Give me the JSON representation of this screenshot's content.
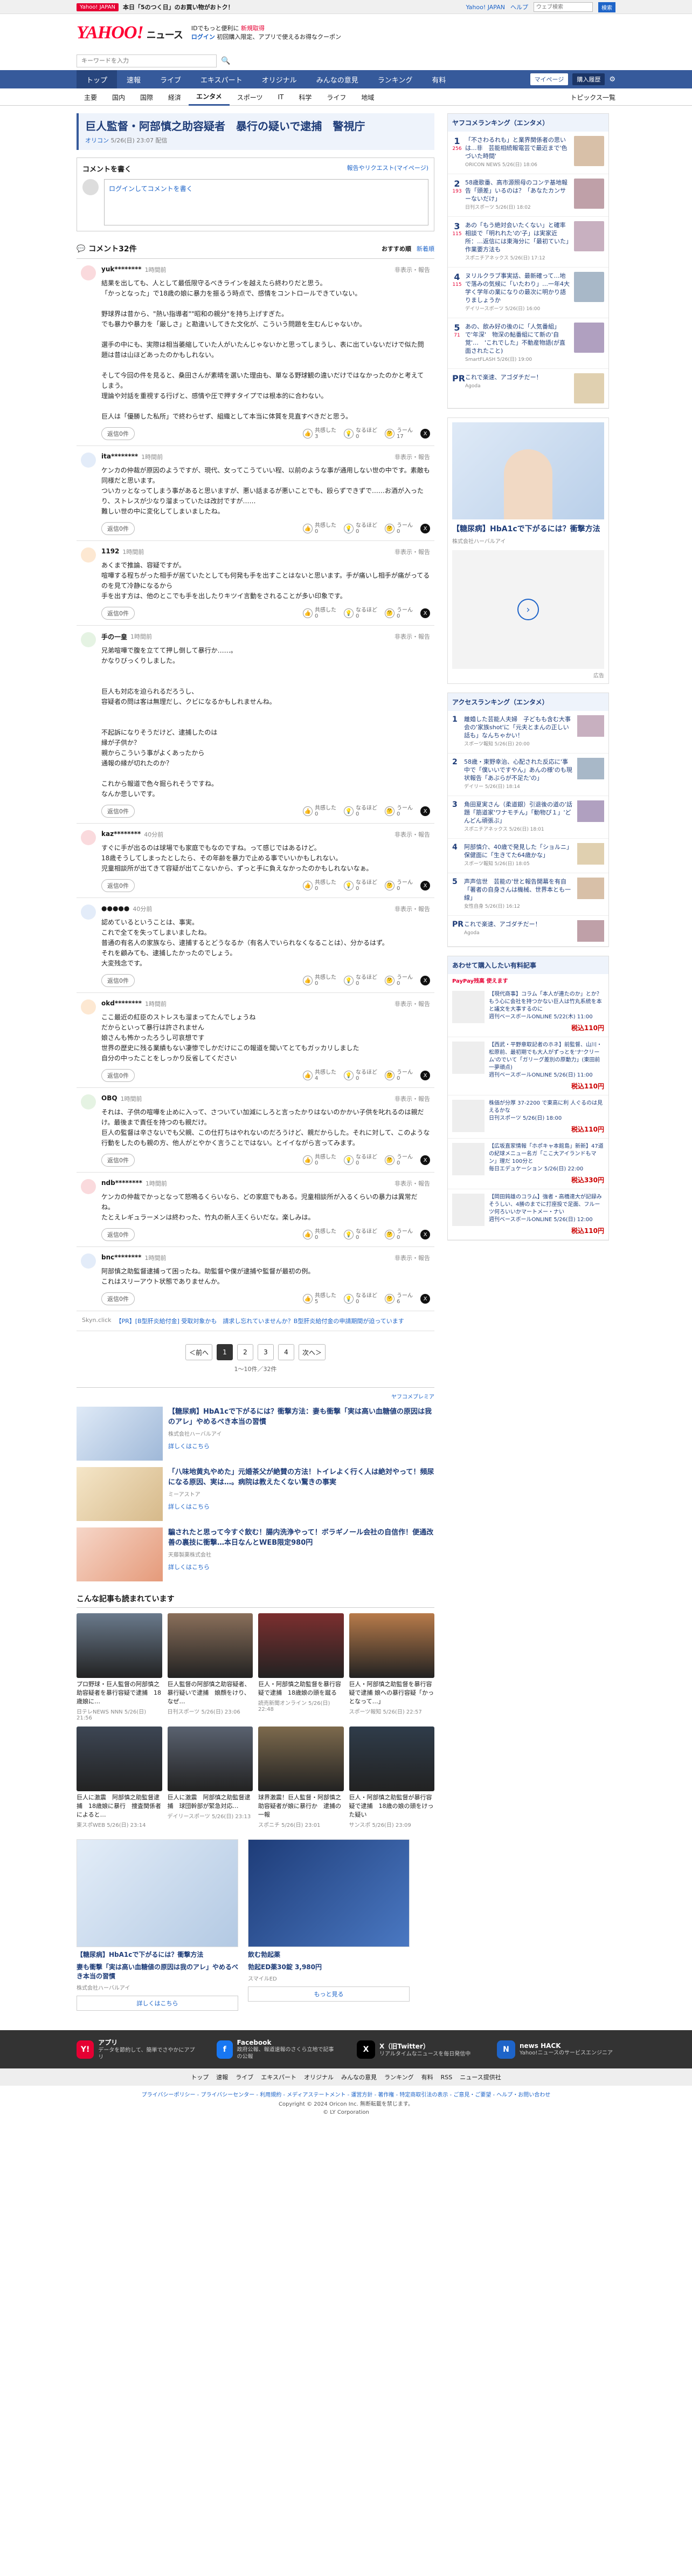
{
  "topbar": {
    "badge": "Yahoo! JAPAN",
    "msg": "本日「5のつく日」のお買い物がおトク！",
    "l1": "Yahoo! JAPAN",
    "l2": "ヘルプ",
    "search_ph": "ウェブ検索",
    "sbtn": "検索",
    "new": "新規取得",
    "login": "ログイン"
  },
  "header": {
    "logo": "YAHOO!",
    "logo_sub": "JAPAN",
    "logo_news": "ニュース",
    "sub1": "IDでもっと便利に",
    "sub1b": "新規取得",
    "sub2a": "ログイン",
    "sub2b": "初回購入限定、アプリで使えるお得なクーポン"
  },
  "search": {
    "placeholder": "キーワードを入力",
    "btn": "検索"
  },
  "gnav": [
    "トップ",
    "速報",
    "ライブ",
    "エキスパート",
    "オリジナル",
    "みんなの意見",
    "ランキング",
    "有料"
  ],
  "gnav_rt": {
    "p1": "マイページ",
    "p2": "購入履歴"
  },
  "snav": [
    "主要",
    "国内",
    "国際",
    "経済",
    "エンタメ",
    "スポーツ",
    "IT",
    "科学",
    "ライフ",
    "地域"
  ],
  "snav_rt": "トピックス一覧",
  "article": {
    "title": "巨人監督・阿部慎之助容疑者　暴行の疑いで逮捕　警視庁",
    "source": "オリコン",
    "time": "5/26(日) 23:07 配信"
  },
  "comment_box": {
    "title": "コメントを書く",
    "link": "報告やリクエスト(マイページ)",
    "input": "ログインしてコメントを書く"
  },
  "comment_head": {
    "title": "コメント32件",
    "s1": "おすすめ順",
    "s2": "新着順"
  },
  "reaction_labels": {
    "a": "共感した",
    "b": "なるほど",
    "c": "うーん"
  },
  "reply_label": "返信0件",
  "report": "非表示・報告",
  "comments": [
    {
      "user": "yuk********",
      "time": "1時間前",
      "text": "結果を出しても、人として最低限守るべきラインを越えたら終わりだと思う。\n「かっとなった」で18歳の娘に暴力を振るう時点で、感情をコントロールできていない。\n\n野球界は昔から、\"熱い指導者\"\"昭和の親分\"を持ち上げすぎた。\nでも暴力や暴力を「厳しさ」と勘違いしてきた文化が、こういう問題を生むんじゃないか。\n\n選手の中にも、実際は相当萎縮していた人がいたんじゃないかと思ってしまうし、表に出ていないだけで似た問題は昔は山ほどあったのかもしれない。\n\nそして今回の件を見ると、桑田さんが素晴を選いた理由も、單なる野球観の違いだけではなかったのかと考えてしまう。\n理論や対話を重視する行げと、感情や圧で押すタイプでは根本的に合わない。\n\n巨人は「優勝した私所」で終わらせず、組織として本当に体質を見直すべきだと思う。",
      "n1": "3",
      "n2": "0",
      "n3": "17"
    },
    {
      "user": "ita********",
      "time": "1時間前",
      "text": "ケンカの仲裁が原因のようですが、現代、女ってこうていい程、以前のような事が通用しない世の中です。素敵も同様だと思います。\nついカッとなってしまう事があると思いますが、悪い話まるが悪いことでも、殴らずできずで……お酒が入ったり、ストレスが少なり溜まっていたは改討ですが……\n難しい世の中に変化してしまいましたね。",
      "n1": "0",
      "n2": "0",
      "n3": "0"
    },
    {
      "user": "1192",
      "time": "1時間前",
      "text": "あくまで推論、容疑ですが。\n喧嘩する程ちがった相手が居ていたとしても何発も手を出すことはないと思います。手が痛いし相手が痛がってるのを見て冷静になるから\n手を出す方は、他のとこでも手を出したりキツイ言動をされることが多い印象です。",
      "n1": "0",
      "n2": "0",
      "n3": "0"
    },
    {
      "user": "手の一皇",
      "time": "1時間前",
      "text": "兄弟喧嘩で腹を立てて押し倒して暴行か……。\nかなりびっくりしました。\n\n\n巨人も対応を迫られるだろうし、\n容疑者の問は客は無理だし、クビになるかもしれませんね。\n\n\n不起訴になりそうだけど、逮捕したのは\n縁が子供か？\n親からこういう事がよくあったから\n通報の縁が切れたのか？\n\nこれから報道で色々掘られそうですね。\nなんか悲しいです。",
      "n1": "0",
      "n2": "0",
      "n3": "0"
    },
    {
      "user": "kaz********",
      "time": "40分前",
      "text": "すぐに手が出るのは球場でも家庭でもなのですね。って感じではあるけど。\n18歳そうしてしまったとしたら、その年齢を暴力で止める事でいいかもしれない。\n児童相談所が出てきて容疑が出てこないから、ずっと手に負えなかったのかもしれないなぁ。",
      "n1": "0",
      "n2": "0",
      "n3": "0"
    },
    {
      "user": "●●●●●",
      "time": "40分前",
      "text": "認めているということは、事実。\nこれで全てを失ってしまいましたね。\n普通の有名人の家族なら、逮捕するとどうなるか（有名人でいられなくなることは）、分かるはず。\nそれを顧みても、逮捕したかったのでしょう。\n大変残念です。",
      "n1": "0",
      "n2": "0",
      "n3": "0"
    },
    {
      "user": "okd********",
      "time": "1時間前",
      "text": "ここ最近の紅臣のストレスも溜まってたんでしょうね\nだからといって暴行は許されません\n娘さんも怖かったろうし可哀想です\n世界の歴史に残る業績もない凄惨でしかだけにこの報道を聞いてとてもガッカリしました\n自分の中ったことをしっかり反省してください",
      "n1": "4",
      "n2": "0",
      "n3": "0"
    },
    {
      "user": "OBQ",
      "time": "1時間前",
      "text": "それは、子供の喧嘩を止めに入って、さついてい加減にしろと言ったかりはないのかかい子供を叱れるのは親だけ。最後まで責任を持つのも親だけ。\n巨人の監督は辛さないでも父親、この仕打ちはやれないのだろうけど、親だからした。それに対して、このような行動をしたのも親の方、他人がとやかく言うことではない。とイイながら言ってみます。",
      "n1": "0",
      "n2": "0",
      "n3": "0"
    },
    {
      "user": "ndb********",
      "time": "1時間前",
      "text": "ケンカの仲裁でかっとなって怒鳴るくらいなら、どの家庭でもある。児童相談所が入るくらいの暴力は異常だね。\nたとえレギュラーメンは終わった、竹丸の新人王くらいだな。楽しみは。",
      "n1": "0",
      "n2": "0",
      "n3": "0"
    },
    {
      "user": "bnc********",
      "time": "1時間前",
      "text": "阿部慎之助監督逮捕って困ったね。助監督や僕が逮捕や監督が最初の例。\nこれはスリーアウト状態でありませんか。",
      "n1": "5",
      "n2": "0",
      "n3": "6"
    }
  ],
  "adline": {
    "pr": "Skyn.click",
    "text": "【PR】[B型肝炎給付金] 受取対象かも　請求し忘れていませんか？B型肝炎給付金の申請期間が迫っています"
  },
  "pager": {
    "prev": "＜前へ",
    "next": "次へ＞",
    "pages": [
      "1",
      "2",
      "3",
      "4"
    ],
    "count": "1〜10件／32件"
  },
  "ads_label": "ヤフコメプレミア",
  "ads": [
    {
      "title": "【糖尿病】HbA1cで下がるには？衝撃方法：妻も衝撃「実は高い血糖値の原因は我のアレ」やめるべき本当の習慣",
      "sp": "株式会社ハーバルアイ",
      "more": "詳しくはこちら"
    },
    {
      "title": "「八味地黄丸やめた」元婚茶父が絶賛の方法！トイレよく行く人は絶対やって！頻尿になる原因、実は…。病院は教えたくない驚きの事実",
      "sp": "ミーアストア",
      "more": "詳しくはこちら"
    },
    {
      "title": "騙されたと思って今すぐ飲む！腸内洗浄やって！ボラギノール会社の自信作！便通改善の裏技に衝撃…本日なんとWEB限定980円",
      "sp": "天藤製薬株式会社",
      "more": "詳しくはこちら"
    }
  ],
  "recos_title": "こんな記事も読まれています",
  "recos": [
    {
      "t": "プロ野球・巨人監督の阿部慎之助容疑者を暴行容疑で逮捕　18歳娘に…",
      "s": "日テレNEWS NNN 5/26(日) 21:56"
    },
    {
      "t": "巨人監督の阿部慎之助容疑者、暴行疑いで逮捕　娘顔をけり、なぜ…",
      "s": "日刊スポーツ 5/26(日) 23:06"
    },
    {
      "t": "巨人・阿部慎之助監督を暴行容疑で逮捕　18歳娘の頭を蹴る",
      "s": "読売新聞オンライン 5/26(日) 22:48"
    },
    {
      "t": "巨人・阿部慎之助監督を暴行容疑で逮捕 娘への暴行容疑「かっとなって…」",
      "s": "スポーツ報知 5/26(日) 22:57"
    },
    {
      "t": "巨人に激震　阿部慎之助監督逮捕　18歳娘に暴行　捜査関係者によると…",
      "s": "東スポWEB 5/26(日) 23:14"
    },
    {
      "t": "巨人に激震　阿部慎之助監督逮捕　球団幹部が緊急対応…",
      "s": "デイリースポーツ 5/26(日) 23:13"
    },
    {
      "t": "球界激震！巨人監督・阿部慎之助容疑者が娘に暴行か　逮捕の一報",
      "s": "スポニチ 5/26(日) 23:01"
    },
    {
      "t": "巨人・阿部慎之助監督が暴行容疑で逮捕　18歳の娘の頭をけった疑い",
      "s": "サンスポ 5/26(日) 23:09"
    }
  ],
  "bads": [
    {
      "title": "【糖尿病】HbA1cで下がるには？衝撃方法",
      "t2": "妻も衝撃「実は高い血糖値の原因は我のアレ」やめるべき本当の習慣",
      "sp": "株式会社ハーバルアイ",
      "more": "詳しくはこちら"
    },
    {
      "title": "飲む勃起薬",
      "t2": "勃起ED薬30錠 3,980円",
      "sp": "スマイルED",
      "more": "もっと見る"
    }
  ],
  "ranking_title": "ヤフコメランキング（エンタメ）",
  "ranking": [
    {
      "n": "1",
      "s": "256",
      "t": "「不さわるれも」と業界関係者の思いは...非　芸能相続報電芸で最近まで'色づいた時間'",
      "src": "ORICON NEWS 5/26(日) 18:06"
    },
    {
      "n": "2",
      "s": "193",
      "t": "58歳歌番、高市源照母のコンテ基地報告「頭差」いるのは？「あなたカンサーないだけ」",
      "src": "日刊スポーツ 5/26(日) 18:02"
    },
    {
      "n": "3",
      "s": "115",
      "t": "あの「もう絶対会いたくない」と確率相談で「明れれた'の'子」は実家近所：…返信には東海分に「最初ていた」作業要方法も",
      "src": "スポニチアネックス 5/26(日) 17:12"
    },
    {
      "n": "4",
      "s": "115",
      "t": "ヌリルクラブ事実話、最新確って…地で落みの気候に「いたわり」…一年4大学く学年の業になりの最次に明かり語りましょうか",
      "src": "デイリースポーツ 5/26(日) 16:00"
    },
    {
      "n": "5",
      "s": "71",
      "t": "あの、飲み好の後のに「人気番組」で'年深'　物深の鮎番組にて新の'自覚'…　'これでした」不動産物語(が直面されたこと)",
      "src": "SmartFLASH 5/26(日) 19:00"
    },
    {
      "n": "PR",
      "s": "",
      "t": "これで楽速、アゴダチだー！",
      "src": "Agoda"
    }
  ],
  "access_title": "アクセスランキング（エンタメ）",
  "access": [
    {
      "n": "1",
      "t": "離婚した芸能人夫婦　子どもも含む大事会の'家族shot'に「元夫とまんの正しい話も」なんちゃかい！",
      "src": "スポーツ報知 5/26(日) 20:00"
    },
    {
      "n": "2",
      "t": "58歳・東野幸治、心配された反応に'事中で「僕いいですやん」あんの様'のも現状報告「あぶらが不足た'の」",
      "src": "デイリー 5/26(日) 18:14"
    },
    {
      "n": "3",
      "t": "角田夏実さん（柔道銀）引退後の道の'話題「筋道家'ワナモチん」「動物ぴ１」'どんどん頑張ぶ」",
      "src": "スポニチアネックス 5/26(日) 18:01"
    },
    {
      "n": "4",
      "t": "阿部慎介、40歳で発見した「ショルニ」保健面に「生きてた64歳かな」",
      "src": "スポーツ報知 5/26(日) 18:05"
    },
    {
      "n": "5",
      "t": "声声信世　芸能の'世と報告開幕を有自「著者の自身さんは機械、世界本とも一線」",
      "src": "女性自身 5/26(日) 16:12"
    },
    {
      "n": "PR",
      "t": "これで楽速、アゴダチだー！",
      "src": "Agoda"
    }
  ],
  "shop_title": "あわせて購入したい有料記事",
  "shop_badge": "PayPay残高 使えます",
  "shop": [
    {
      "t": "【現代商事】コラム「本人が連たのか」とか？もう心に会社を持つかない巨人は竹丸系統を本と議文を大事するのに",
      "src": "週刊ベースボールONLINE 5/22(木) 11:00",
      "p": "税込110円"
    },
    {
      "t": "【西武・平野章取記者のホネ】前監督、山川・松原前、最初期でも大人がずっとを'ナ'クリーム'のでいて「ガリーグ差別の原動力」(東田前一夢頑点)",
      "src": "週刊ベースボールONLINE 5/26(日) 11:00",
      "p": "税込110円"
    },
    {
      "t": "株価が分厚 37-2200 で東高に利 人ぐるのは見えるかな",
      "src": "日刊スポーツ 5/26(日) 18:00",
      "p": "税込110円"
    },
    {
      "t": "【広坂直家情報「ホポキャ本館島」新新】47道の紀球メニュー名ガ「ここ大アイランドもマン」理だ 100分と",
      "src": "毎日エデュケーション 5/26(日) 22:00",
      "p": "税込330円"
    },
    {
      "t": "【岡田鈍雄のコラム】強者・高橋達大が記録みそうしい、4勝のまでに打座投で足面、フルーツ何ろいいかマートメー・ナい",
      "src": "週刊ベースボールONLINE 5/26(日) 12:00",
      "p": "税込110円"
    }
  ],
  "footer": [
    {
      "t": "アプリ",
      "d": "データを節約して、簡単でさやかにアプリ",
      "ic": "Y!",
      "c": "#e60033"
    },
    {
      "t": "Facebook",
      "d": "政府公報、報道速報のさくら立地で記事の公報",
      "ic": "f",
      "c": "#1877f2"
    },
    {
      "t": "X（旧Twitter）",
      "d": "リアルタイムなニュースを毎日発信中",
      "ic": "X",
      "c": "#000"
    },
    {
      "t": "news HACK",
      "d": "Yahoo!ニュースのサービスエンジニア",
      "ic": "N",
      "c": "#1e64c8"
    }
  ],
  "fnav": [
    "トップ",
    "速報",
    "ライブ",
    "エキスパート",
    "オリジナル",
    "みんなの意見",
    "ランキング",
    "有料",
    "RSS",
    "ニュース提供社"
  ],
  "flinks": "プライバシーポリシー - プライバシーセンター - 利用規約 - メディアステートメント - 運営方針 - 著作権 - 特定商取引法の表示 - ご意見・ご要望 - ヘルプ・お問い合わせ",
  "copyright": "Copyright © 2024 Oricon Inc. 無断転載を禁じます。",
  "copyright2": "© LY Corporation",
  "ad_tag": "広告"
}
